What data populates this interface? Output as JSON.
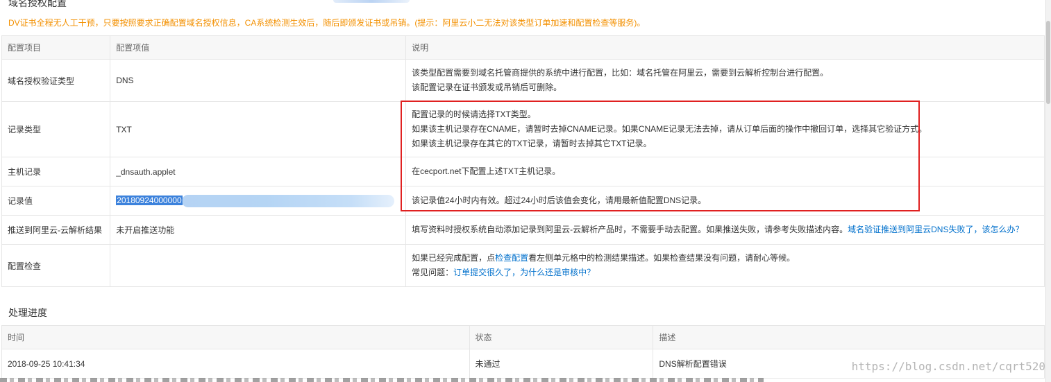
{
  "section_title": "域名授权配置",
  "notice": "DV证书全程无人工干预，只要按照要求正确配置域名授权信息，CA系统检测生效后，随后即颁发证书或吊销。(提示：阿里云小二无法对该类型订单加速和配置检查等服务)。",
  "config_table": {
    "headers": [
      "配置项目",
      "配置项值",
      "说明"
    ],
    "rows": [
      {
        "item": "域名授权验证类型",
        "value": "DNS",
        "desc": [
          "该类型配置需要到域名托管商提供的系统中进行配置，比如：域名托管在阿里云，需要到云解析控制台进行配置。",
          "该配置记录在证书颁发或吊销后可删除。"
        ]
      },
      {
        "item": "记录类型",
        "value": "TXT",
        "desc": [
          "配置记录的时候请选择TXT类型。",
          "如果该主机记录存在CNAME，请暂时去掉CNAME记录。如果CNAME记录无法去掉，请从订单后面的操作中撤回订单，选择其它验证方式。",
          "如果该主机记录存在其它的TXT记录，请暂时去掉其它TXT记录。"
        ]
      },
      {
        "item": "主机记录",
        "value": "_dnsauth.applet",
        "desc": [
          "在cecport.net下配置上述TXT主机记录。"
        ]
      },
      {
        "item": "记录值",
        "value": "20180924000000",
        "desc": [
          "该记录值24小时内有效。超过24小时后该值会变化，请用最新值配置DNS记录。"
        ]
      },
      {
        "item": "推送到阿里云-云解析结果",
        "value": "未开启推送功能",
        "desc_text": "填写资料时授权系统自动添加记录到阿里云-云解析产品时，不需要手动去配置。如果推送失败，请参考失败描述内容。",
        "desc_link": "域名验证推送到阿里云DNS失败了，该怎么办？"
      },
      {
        "item": "配置检查",
        "value": "",
        "desc_pre": "如果已经完成配置，点",
        "desc_link1": "检查配置",
        "desc_post": "看左侧单元格中的检测结果描述。如果检查结果没有问题，请耐心等候。",
        "desc2_pre": "常见问题：",
        "desc2_link": "订单提交很久了，为什么还是审核中？"
      }
    ]
  },
  "progress": {
    "title": "处理进度",
    "headers": [
      "时间",
      "状态",
      "描述"
    ],
    "rows": [
      {
        "time": "2018-09-25 10:41:34",
        "status": "未通过",
        "desc": "DNS解析配置错误"
      }
    ]
  },
  "watermark": "https://blog.csdn.net/cqrt520",
  "colors": {
    "notice": "#f39000",
    "link": "#0070cc",
    "highlight_box": "#e02020",
    "selection": "#3c82dc"
  }
}
